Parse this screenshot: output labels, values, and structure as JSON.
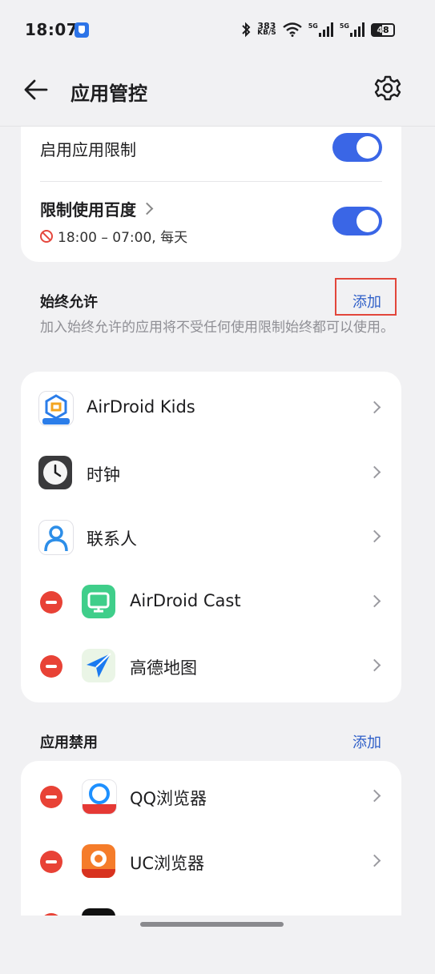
{
  "status_bar": {
    "time": "18:07",
    "speed_value": "383",
    "speed_unit": "KB/S",
    "sim1": "5G",
    "sim2": "5G",
    "battery": "48"
  },
  "header": {
    "title": "应用管控"
  },
  "restrictions": {
    "enable_label": "启用应用限制",
    "enable_on": true,
    "limit_label": "限制使用百度",
    "limit_schedule": "18:00 – 07:00, 每天",
    "limit_on": true
  },
  "always_allowed": {
    "title": "始终允许",
    "add_label": "添加",
    "description": "加入始终允许的应用将不受任何使用限制始终都可以使用。",
    "apps": [
      {
        "name": "AirDroid Kids",
        "removable": false,
        "icon": "airdroid-kids-icon"
      },
      {
        "name": "时钟",
        "removable": false,
        "icon": "clock-icon"
      },
      {
        "name": "联系人",
        "removable": false,
        "icon": "contacts-icon"
      },
      {
        "name": "AirDroid Cast",
        "removable": true,
        "icon": "airdroid-cast-icon"
      },
      {
        "name": "高德地图",
        "removable": true,
        "icon": "amap-icon"
      }
    ]
  },
  "blocked": {
    "title": "应用禁用",
    "add_label": "添加",
    "apps": [
      {
        "name": "QQ浏览器",
        "icon": "qq-browser-icon"
      },
      {
        "name": "UC浏览器",
        "icon": "uc-browser-icon"
      }
    ]
  },
  "colors": {
    "accent": "#3a66e6",
    "link": "#2f5fc8",
    "danger": "#e84236",
    "highlight": "#e2463b"
  }
}
